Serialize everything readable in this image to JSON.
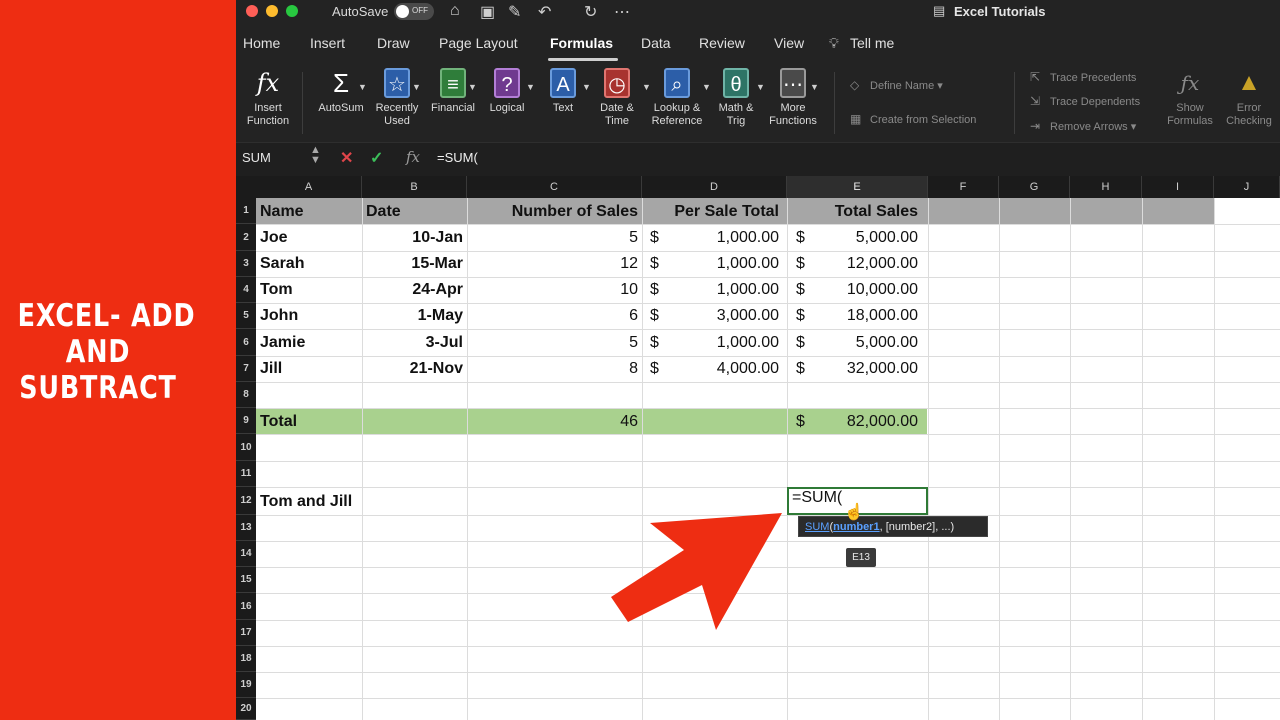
{
  "banner": {
    "lines": [
      "EXCEL- ADD",
      "AND",
      "SUBTRACT"
    ]
  },
  "titlebar": {
    "autosave_label": "AutoSave",
    "autosave_state": "OFF",
    "document_title": "Excel Tutorials"
  },
  "tabs": [
    "Home",
    "Insert",
    "Draw",
    "Page Layout",
    "Formulas",
    "Data",
    "Review",
    "View",
    "Tell me"
  ],
  "ribbon": {
    "insert_function": "Insert Function",
    "buttons": [
      {
        "label": "AutoSum",
        "icon": "sigma-icon"
      },
      {
        "label": "Recently Used",
        "icon": "star-icon"
      },
      {
        "label": "Financial",
        "icon": "coins-icon"
      },
      {
        "label": "Logical",
        "icon": "question-icon"
      },
      {
        "label": "Text",
        "icon": "text-icon"
      },
      {
        "label": "Date & Time",
        "icon": "clock-icon"
      },
      {
        "label": "Lookup & Reference",
        "icon": "magnifier-icon"
      },
      {
        "label": "Math & Trig",
        "icon": "theta-icon"
      },
      {
        "label": "More Functions",
        "icon": "more-icon"
      }
    ],
    "define_name": "Define Name",
    "create_from_selection": "Create from Selection",
    "trace_precedents": "Trace Precedents",
    "trace_dependents": "Trace Dependents",
    "remove_arrows": "Remove Arrows",
    "show_formulas": "Show Formulas",
    "error_checking": "Error Checking"
  },
  "formula_bar": {
    "name_box": "SUM",
    "fx": "fx",
    "formula": "=SUM("
  },
  "columns": [
    "A",
    "B",
    "C",
    "D",
    "E",
    "F",
    "G",
    "H",
    "I",
    "J"
  ],
  "rows": [
    "1",
    "2",
    "3",
    "4",
    "5",
    "6",
    "7",
    "8",
    "9",
    "10",
    "11",
    "12",
    "13",
    "14",
    "15",
    "16",
    "17",
    "18",
    "19",
    "20"
  ],
  "header_row": {
    "name": "Name",
    "date": "Date",
    "sales": "Number of Sales",
    "per_sale": "Per Sale Total",
    "total": "Total Sales"
  },
  "data_rows": [
    {
      "name": "Joe",
      "date": "10-Jan",
      "sales": "5",
      "per_sale": "1,000.00",
      "total": "5,000.00"
    },
    {
      "name": "Sarah",
      "date": "15-Mar",
      "sales": "12",
      "per_sale": "1,000.00",
      "total": "12,000.00"
    },
    {
      "name": "Tom",
      "date": "24-Apr",
      "sales": "10",
      "per_sale": "1,000.00",
      "total": "10,000.00"
    },
    {
      "name": "John",
      "date": "1-May",
      "sales": "6",
      "per_sale": "3,000.00",
      "total": "18,000.00"
    },
    {
      "name": "Jamie",
      "date": "3-Jul",
      "sales": "5",
      "per_sale": "1,000.00",
      "total": "5,000.00"
    },
    {
      "name": "Jill",
      "date": "21-Nov",
      "sales": "8",
      "per_sale": "4,000.00",
      "total": "32,000.00"
    }
  ],
  "currency_symbol": "$",
  "total_row": {
    "label": "Total",
    "sales": "46",
    "total": "82,000.00"
  },
  "row12_label": "Tom and Jill",
  "active_cell_text": "=SUM(",
  "tooltip": {
    "fn": "SUM",
    "arg1": "number1",
    "rest": ", [number2], ...)"
  },
  "ref_tip": "E13",
  "colors": {
    "banner": "#ee2d12",
    "header_fill": "#a6a6a6",
    "total_fill": "#a9d18e",
    "arrow": "#ee2d12"
  }
}
